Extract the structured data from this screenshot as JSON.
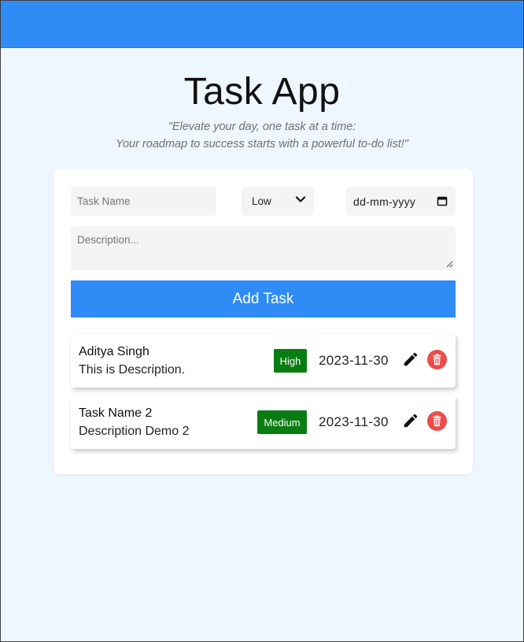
{
  "header": {
    "title": "Task App",
    "tagline_line1": "\"Elevate your day, one task at a time:",
    "tagline_line2": "Your roadmap to success starts with a powerful to-do list!\""
  },
  "form": {
    "task_name_placeholder": "Task Name",
    "priority_selected": "Low",
    "date_placeholder": "dd-mm-yyyy",
    "description_placeholder": "Description...",
    "add_button_label": "Add Task"
  },
  "tasks": [
    {
      "name": "Aditya Singh",
      "description": "This is Description.",
      "priority": "High",
      "due": "2023-11-30"
    },
    {
      "name": "Task Name 2",
      "description": "Description Demo 2",
      "priority": "Medium",
      "due": "2023-11-30"
    }
  ],
  "colors": {
    "accent": "#2f8cf7",
    "badge": "#0a7d12",
    "delete": "#ee4b4b",
    "background": "#eef6ff"
  },
  "icons": [
    "chevron-down-icon",
    "calendar-icon",
    "resize-grip-icon",
    "pencil-icon",
    "trash-icon"
  ]
}
